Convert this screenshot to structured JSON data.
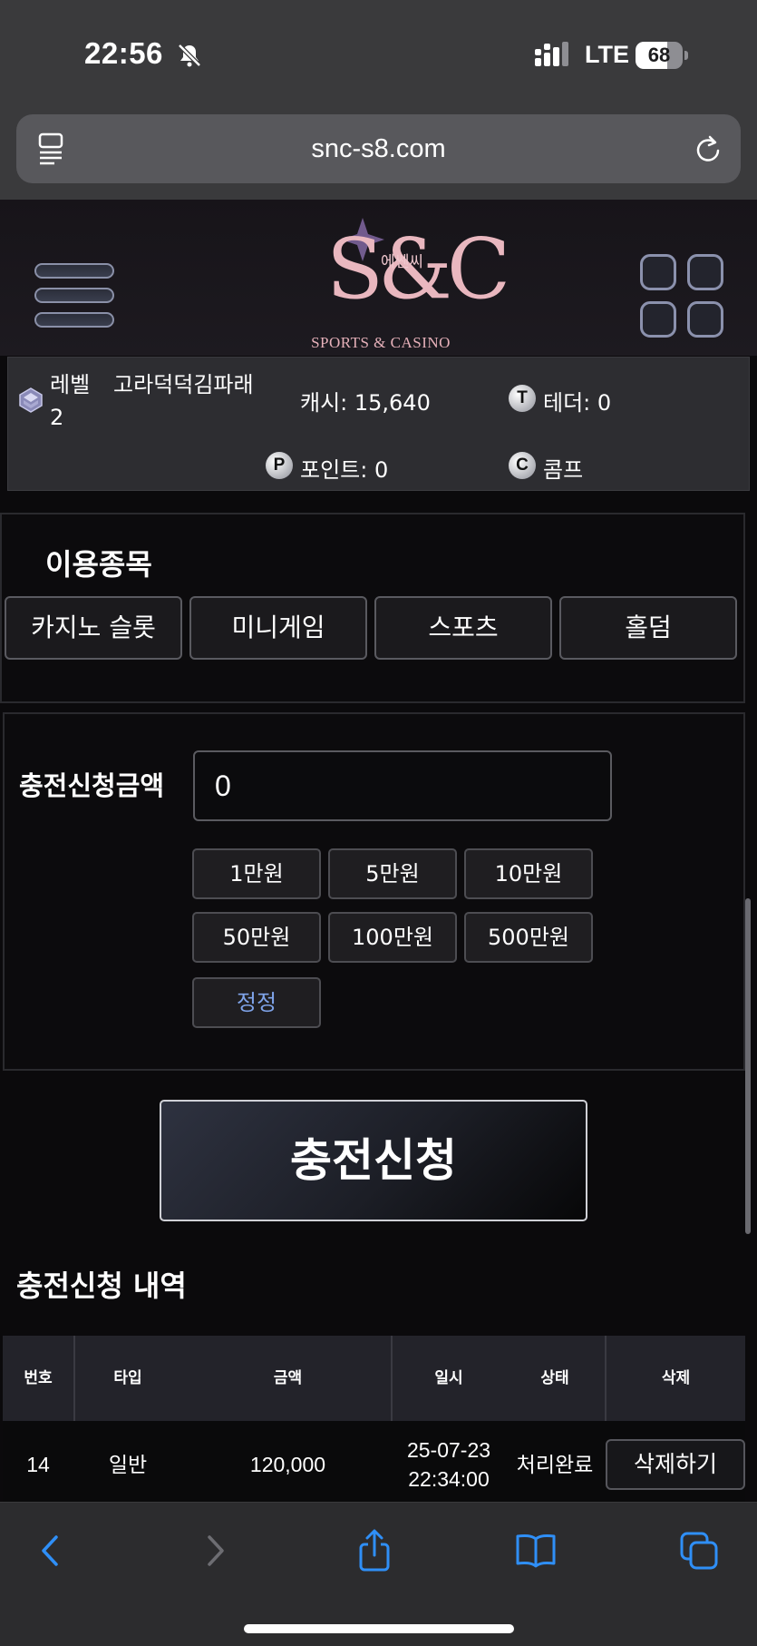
{
  "status_bar": {
    "time": "22:56",
    "network": "LTE",
    "battery_percent": "68",
    "battery_level": 0.68
  },
  "browser": {
    "url": "snc-s8.com"
  },
  "site": {
    "logo_mark": "S&C",
    "logo_korean": "에쎈씨",
    "logo_tagline": "SPORTS & CASINO"
  },
  "user": {
    "level_label": "레벨 2",
    "nickname": "고라덕덕김파래",
    "cash": "캐시: 15,640",
    "tether": "테더: 0",
    "point": "포인트: 0",
    "comp": "콤프",
    "tether_icon": "T",
    "point_icon": "P",
    "comp_icon": "C"
  },
  "games": {
    "title": "이용종목",
    "items": [
      "카지노 슬롯",
      "미니게임",
      "스포츠",
      "홀덤"
    ]
  },
  "deposit": {
    "label": "충전신청금액",
    "amount_value": "0",
    "quick_amounts": [
      "1만원",
      "5만원",
      "10만원",
      "50만원",
      "100만원",
      "500만원"
    ],
    "reset_label": "정정",
    "submit_label": "충전신청"
  },
  "history": {
    "title": "충전신청 내역",
    "columns": [
      "번호",
      "타입",
      "금액",
      "일시",
      "상태",
      "삭제"
    ],
    "rows": [
      {
        "no": "14",
        "type": "일반",
        "amount": "120,000",
        "date": "25-07-23",
        "time": "22:34:00",
        "status": "처리완료",
        "delete_label": "삭제하기"
      }
    ]
  },
  "colors": {
    "accent_reset": "#7fa4ea",
    "logo_pink": "#e9b7bf",
    "header_bg": "#23232a"
  },
  "toolbar": {
    "icons": [
      "back-icon",
      "forward-icon",
      "share-icon",
      "bookmarks-icon",
      "tabs-icon"
    ]
  }
}
